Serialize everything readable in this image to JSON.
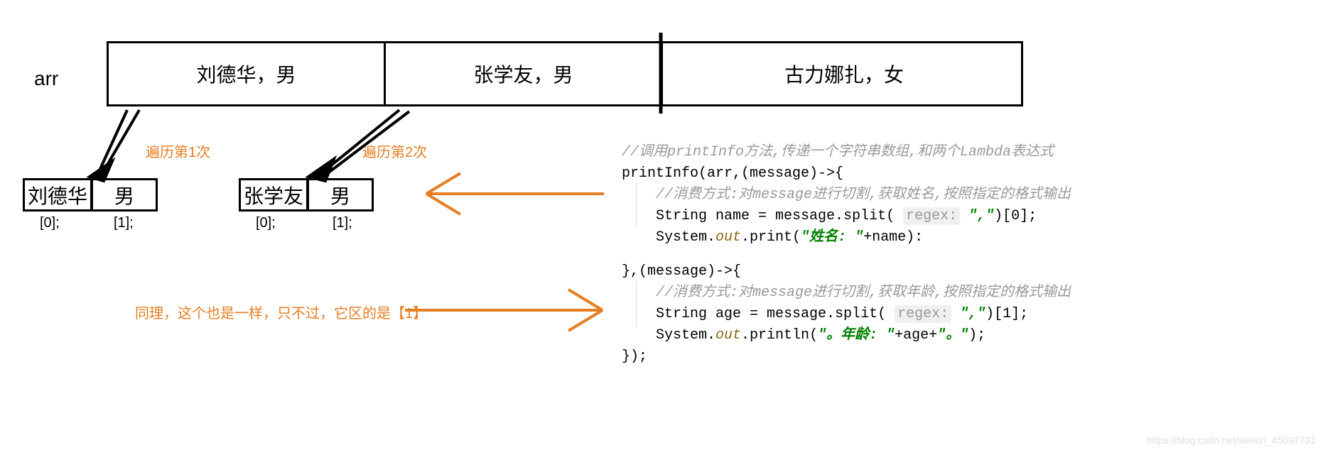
{
  "arr_label": "arr",
  "array_items": [
    "刘德华，男",
    "张学友，男",
    "古力娜扎，女"
  ],
  "iterations": [
    {
      "label": "遍历第1次",
      "cells": [
        "刘德华",
        "男"
      ],
      "indices": [
        "[0];",
        "[1];"
      ]
    },
    {
      "label": "遍历第2次",
      "cells": [
        "张学友",
        "男"
      ],
      "indices": [
        "[0];",
        "[1];"
      ]
    }
  ],
  "bottom_note": "同理，这个也是一样，只不过，它区的是【1】",
  "code": {
    "comment_top": "//调用printInfo方法,传递一个字符串数组,和两个Lambda表达式",
    "line_call": "printInfo(arr,(message)->{",
    "comment_lambda1": "//消费方式:对message进行切割,获取姓名,按照指定的格式输出",
    "l1_name_a": "String name = message.split(",
    "regex_hint": "regex:",
    "split_arg": "\",\"",
    "l1_name_b": ")[0];",
    "l1_print_a": "System.",
    "out": "out",
    "l1_print_b": ".print(",
    "l1_print_str": "\"姓名: \"",
    "l1_print_c": "+name):",
    "mid": "},(message)->{",
    "comment_lambda2": "//消费方式:对message进行切割,获取年龄,按照指定的格式输出",
    "l2_age_a": "String age = message.split(",
    "l2_age_b": ")[1];",
    "l2_print_b": ".println(",
    "l2_print_str": "\"。年龄: \"",
    "l2_print_c": "+age+",
    "l2_print_str2": "\"。\"",
    "l2_print_d": ");",
    "end": "});"
  },
  "watermark": "https://blog.csdn.net/weixin_45097731"
}
